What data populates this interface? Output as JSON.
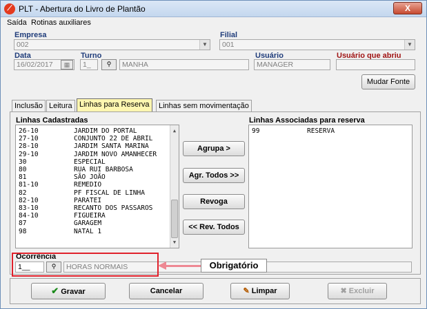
{
  "window": {
    "title": "PLT - Abertura do Livro de Plantão",
    "close_label": "X"
  },
  "menu": {
    "items": [
      "Saída",
      "Rotinas auxiliares"
    ]
  },
  "form": {
    "empresa_label": "Empresa",
    "empresa_value": "002",
    "filial_label": "Filial",
    "filial_value": "001",
    "data_label": "Data",
    "data_value": "16/02/2017",
    "turno_label": "Turno",
    "turno_code": "1_",
    "turno_name": "MANHA",
    "usuario_label": "Usuário",
    "usuario_value": "MANAGER",
    "usuario_abriu_label": "Usuário que abriu",
    "usuario_abriu_value": "",
    "mudar_fonte": "Mudar Fonte"
  },
  "tabs": [
    "Inclusão",
    "Leitura",
    "Linhas para Reserva",
    "Linhas sem movimentação"
  ],
  "left_list": {
    "title": "Linhas Cadastradas",
    "rows": [
      {
        "code": "26-10",
        "name": "JARDIM DO PORTAL"
      },
      {
        "code": "27-10",
        "name": "CONJUNTO 22 DE ABRIL"
      },
      {
        "code": "28-10",
        "name": "JARDIM SANTA MARINA"
      },
      {
        "code": "29-10",
        "name": "JARDIM NOVO AMANHECER"
      },
      {
        "code": "30",
        "name": "ESPECIAL"
      },
      {
        "code": "80",
        "name": "RUA RUI BARBOSA"
      },
      {
        "code": "81",
        "name": "SÃO JOÃO"
      },
      {
        "code": "81-10",
        "name": "REMEDIO"
      },
      {
        "code": "82",
        "name": "PF FISCAL DE LINHA"
      },
      {
        "code": "82-10",
        "name": "PARATEI"
      },
      {
        "code": "83-10",
        "name": "RECANTO DOS PASSAROS"
      },
      {
        "code": "84-10",
        "name": "FIGUEIRA"
      },
      {
        "code": "87",
        "name": "GARAGEM"
      },
      {
        "code": "98",
        "name": "NATAL 1"
      }
    ]
  },
  "right_list": {
    "title": "Linhas Associadas para reserva",
    "rows": [
      {
        "code": "99",
        "name": "RESERVA"
      }
    ]
  },
  "buttons": {
    "agrupa": "Agrupa >",
    "agr_todos": "Agr. Todos >>",
    "revoga": "Revoga",
    "rev_todos": "<< Rev. Todos"
  },
  "ocorrencia": {
    "label": "Ocorrência",
    "code": "1__",
    "name": "HORAS NORMAIS"
  },
  "callout": "Obrigatório",
  "bottom": {
    "gravar": "Gravar",
    "cancelar": "Cancelar",
    "limpar": "Limpar",
    "excluir": "Excluir"
  }
}
